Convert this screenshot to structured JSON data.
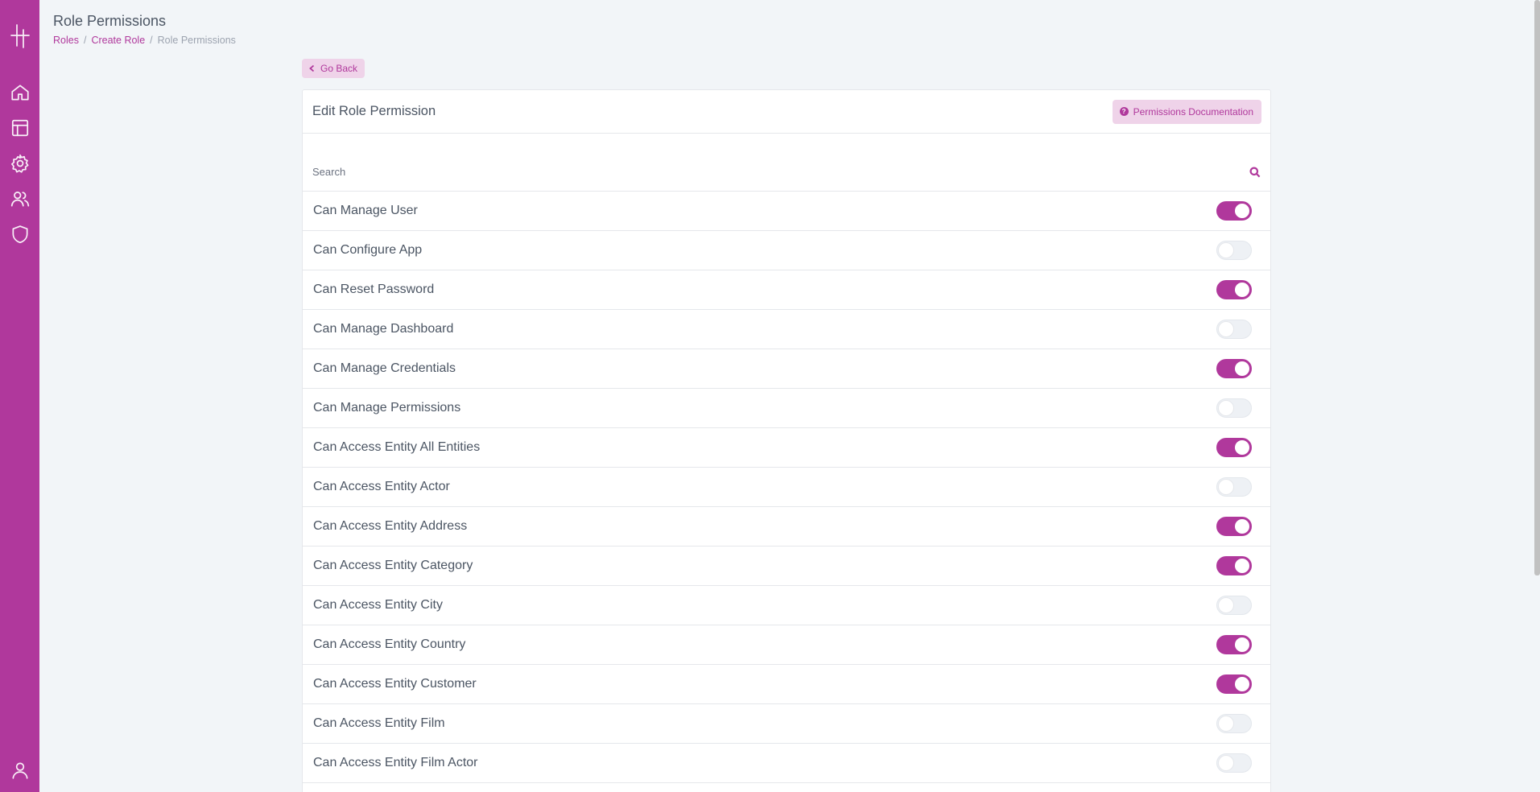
{
  "app": {
    "brand_color": "#b0389c"
  },
  "sidebar": {
    "logo_icon": "app-logo",
    "items": [
      {
        "icon": "home-icon"
      },
      {
        "icon": "table-icon"
      },
      {
        "icon": "gear-icon"
      },
      {
        "icon": "users-icon"
      },
      {
        "icon": "shield-icon"
      }
    ],
    "bottom_icon": "user-icon"
  },
  "header": {
    "title": "Role Permissions",
    "breadcrumb": [
      "Roles",
      "Create Role",
      "Role Permissions"
    ],
    "breadcrumb_separator": "/"
  },
  "go_back_label": "Go Back",
  "card": {
    "title": "Edit Role Permission",
    "docs_label": "Permissions Documentation",
    "docs_icon_glyph": "?",
    "search_placeholder": "Search"
  },
  "permissions": [
    {
      "label": "Can Manage User",
      "enabled": true
    },
    {
      "label": "Can Configure App",
      "enabled": false
    },
    {
      "label": "Can Reset Password",
      "enabled": true
    },
    {
      "label": "Can Manage Dashboard",
      "enabled": false
    },
    {
      "label": "Can Manage Credentials",
      "enabled": true
    },
    {
      "label": "Can Manage Permissions",
      "enabled": false
    },
    {
      "label": "Can Access Entity All Entities",
      "enabled": true
    },
    {
      "label": "Can Access Entity Actor",
      "enabled": false
    },
    {
      "label": "Can Access Entity Address",
      "enabled": true
    },
    {
      "label": "Can Access Entity Category",
      "enabled": true
    },
    {
      "label": "Can Access Entity City",
      "enabled": false
    },
    {
      "label": "Can Access Entity Country",
      "enabled": true
    },
    {
      "label": "Can Access Entity Customer",
      "enabled": true
    },
    {
      "label": "Can Access Entity Film",
      "enabled": false
    },
    {
      "label": "Can Access Entity Film Actor",
      "enabled": false
    }
  ]
}
